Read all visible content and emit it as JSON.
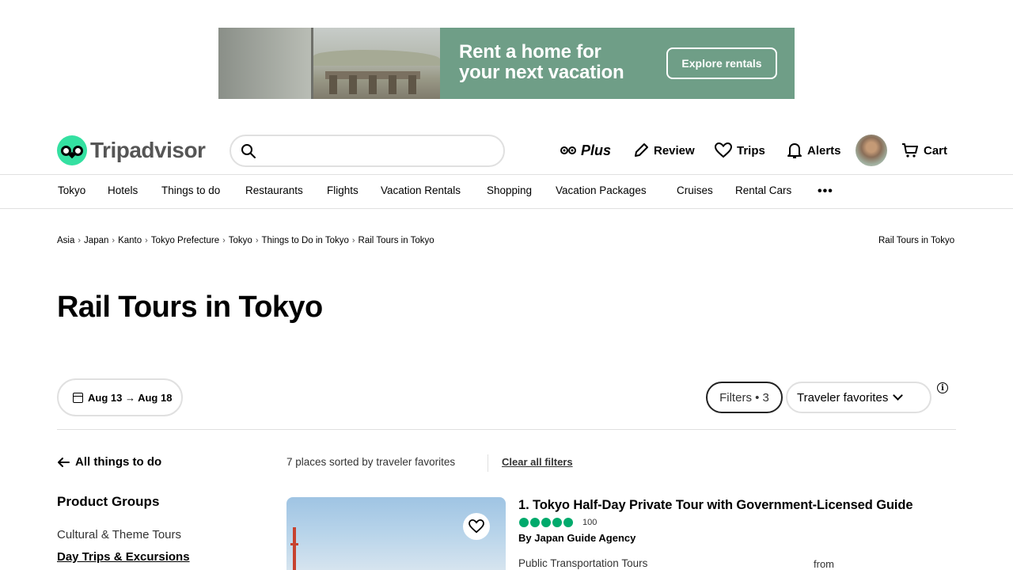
{
  "ad": {
    "headline_line1": "Rent a home for",
    "headline_line2": "your next vacation",
    "button_label": "Explore rentals",
    "bg_color": "#6f9e87"
  },
  "header": {
    "logo_text": "Tripadvisor",
    "search_placeholder": "",
    "nav": {
      "plus_label": "Plus",
      "review_label": "Review",
      "trips_label": "Trips",
      "alerts_label": "Alerts",
      "cart_label": "Cart"
    },
    "brand_color": "#34e0a1"
  },
  "subnav": {
    "items": [
      "Tokyo",
      "Hotels",
      "Things to do",
      "Restaurants",
      "Flights",
      "Vacation Rentals",
      "Shopping",
      "Vacation Packages",
      "Cruises",
      "Rental Cars"
    ],
    "more_label": "•••"
  },
  "breadcrumb": {
    "items": [
      "Asia",
      "Japan",
      "Kanto",
      "Tokyo Prefecture",
      "Tokyo",
      "Things to Do in Tokyo",
      "Rail Tours in Tokyo"
    ],
    "separator": "›",
    "right_label": "Rail Tours in Tokyo"
  },
  "page": {
    "title": "Rail Tours in Tokyo"
  },
  "controls": {
    "dates": "Aug 13 → Aug 18",
    "filters": "Filters • 3",
    "sort": "Traveler favorites",
    "info": "i"
  },
  "results": {
    "back_label": "All things to do",
    "sort_summary": "7 places sorted by traveler favorites",
    "clear_filters": "Clear all filters"
  },
  "sidebar": {
    "groups_title": "Product Groups",
    "items": [
      "Cultural & Theme Tours",
      "Day Trips & Excursions"
    ]
  },
  "listing": {
    "title": "1. Tokyo Half-Day Private Tour with Government-Licensed Guide",
    "rating_bubbles": 5,
    "review_count": "100",
    "agency": "By Japan Guide Agency",
    "category": "Public Transportation Tours",
    "price_prefix": "from",
    "rating_color": "#00aa6c"
  }
}
